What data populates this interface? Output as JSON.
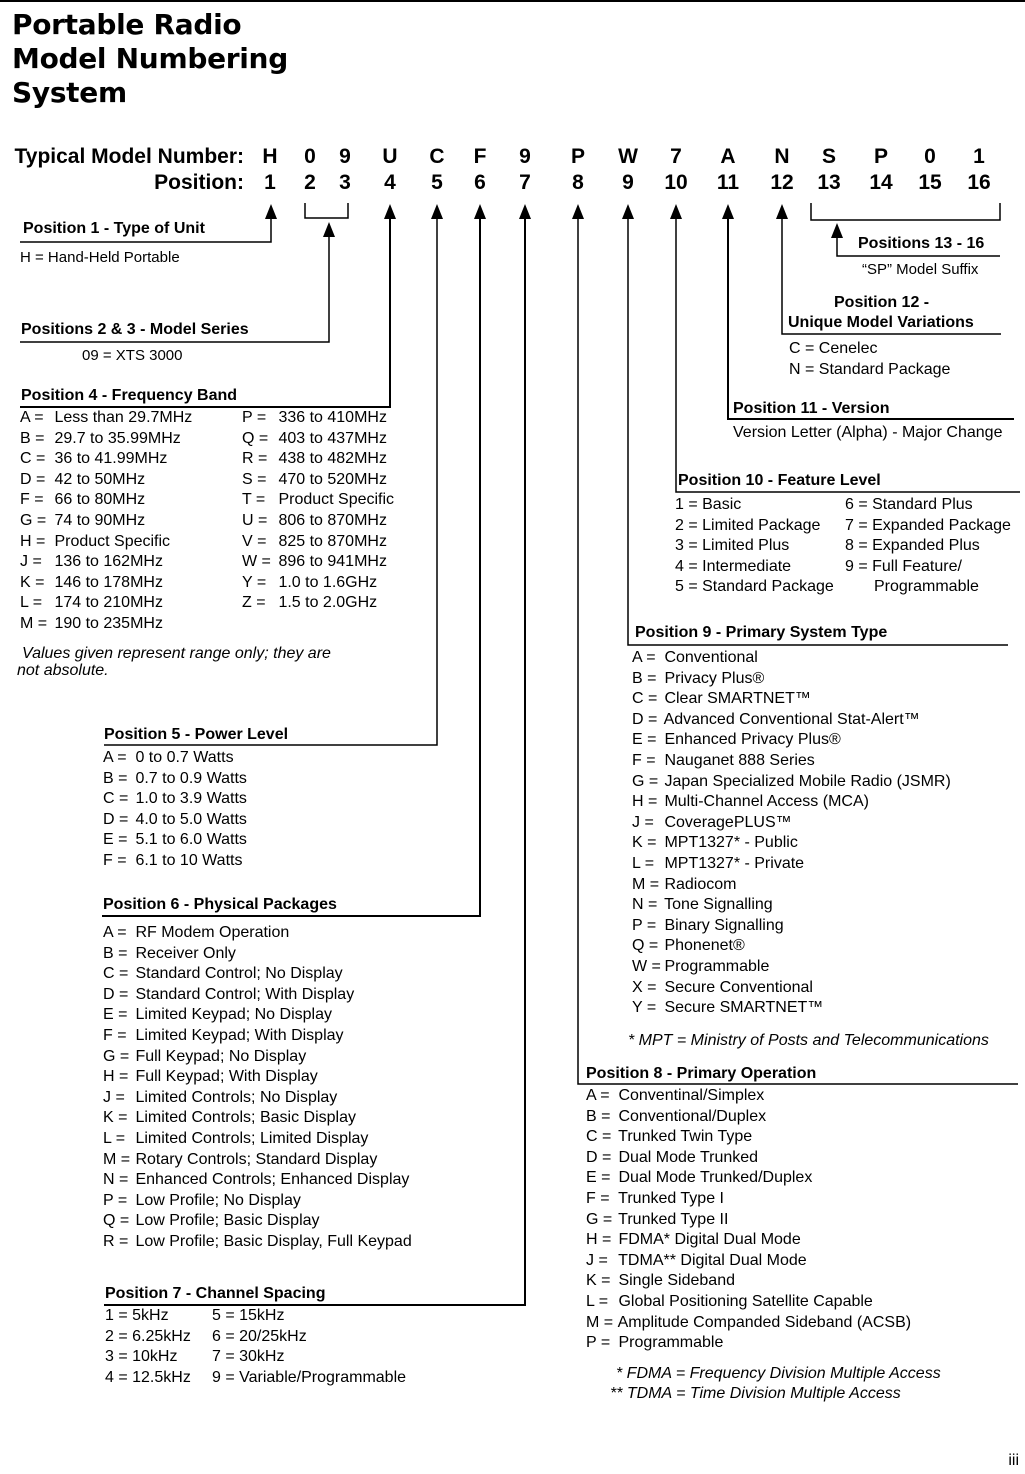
{
  "title": [
    "Portable Radio",
    "Model Numbering",
    "System"
  ],
  "header": {
    "model_label": "Typical Model Number:",
    "position_label": "Position:",
    "model_chars": [
      "H",
      "0",
      "9",
      "U",
      "C",
      "F",
      "9",
      "P",
      "W",
      "7",
      "A",
      "N",
      "S",
      "P",
      "0",
      "1"
    ],
    "positions": [
      "1",
      "2",
      "3",
      "4",
      "5",
      "6",
      "7",
      "8",
      "9",
      "10",
      "11",
      "12",
      "13",
      "14",
      "15",
      "16"
    ]
  },
  "sections": {
    "pos1": {
      "title": "Position 1 - Type of Unit",
      "items": [
        "H = Hand-Held Portable"
      ]
    },
    "pos23": {
      "title": "Positions 2 & 3 - Model Series",
      "items": [
        "09 = XTS 3000"
      ]
    },
    "pos4": {
      "title": "Position 4 - Frequency Band",
      "col1": [
        {
          "k": "A",
          "v": "Less than 29.7MHz"
        },
        {
          "k": "B",
          "v": "29.7 to 35.99MHz"
        },
        {
          "k": "C",
          "v": "36 to 41.99MHz"
        },
        {
          "k": "D",
          "v": "42 to 50MHz"
        },
        {
          "k": "F",
          "v": "66 to 80MHz"
        },
        {
          "k": "G",
          "v": "74 to 90MHz"
        },
        {
          "k": "H",
          "v": "Product Specific"
        },
        {
          "k": "J",
          "v": "136 to 162MHz"
        },
        {
          "k": "K",
          "v": "146 to 178MHz"
        },
        {
          "k": "L",
          "v": "174 to 210MHz"
        },
        {
          "k": "M",
          "v": "190 to 235MHz"
        }
      ],
      "col2": [
        {
          "k": "P",
          "v": "336 to 410MHz"
        },
        {
          "k": "Q",
          "v": "403 to 437MHz"
        },
        {
          "k": "R",
          "v": "438 to 482MHz"
        },
        {
          "k": "S",
          "v": "470 to 520MHz"
        },
        {
          "k": "T",
          "v": "Product Specific"
        },
        {
          "k": "U",
          "v": "806 to 870MHz"
        },
        {
          "k": "V",
          "v": "825 to 870MHz"
        },
        {
          "k": "W",
          "v": "896 to 941MHz"
        },
        {
          "k": "Y",
          "v": "1.0 to 1.6GHz"
        },
        {
          "k": "Z",
          "v": "1.5 to 2.0GHz"
        }
      ],
      "note": [
        "Values given represent range only; they are",
        "not absolute."
      ]
    },
    "pos5": {
      "title": "Position 5 - Power Level",
      "items": [
        {
          "k": "A",
          "v": "0 to 0.7 Watts"
        },
        {
          "k": "B",
          "v": "0.7 to 0.9 Watts"
        },
        {
          "k": "C",
          "v": "1.0 to 3.9 Watts"
        },
        {
          "k": "D",
          "v": "4.0 to 5.0 Watts"
        },
        {
          "k": "E",
          "v": "5.1 to 6.0 Watts"
        },
        {
          "k": "F",
          "v": "6.1 to 10 Watts"
        }
      ]
    },
    "pos6": {
      "title": "Position 6 - Physical Packages",
      "items": [
        {
          "k": "A",
          "v": "RF Modem Operation"
        },
        {
          "k": "B",
          "v": "Receiver Only"
        },
        {
          "k": "C",
          "v": "Standard Control; No Display"
        },
        {
          "k": "D",
          "v": "Standard Control; With Display"
        },
        {
          "k": "E",
          "v": "Limited Keypad; No Display"
        },
        {
          "k": "F",
          "v": "Limited Keypad; With Display"
        },
        {
          "k": "G",
          "v": "Full Keypad; No Display"
        },
        {
          "k": "H",
          "v": "Full Keypad; With Display"
        },
        {
          "k": "J",
          "v": "Limited Controls; No Display"
        },
        {
          "k": "K",
          "v": "Limited Controls; Basic Display"
        },
        {
          "k": "L",
          "v": "Limited Controls; Limited Display"
        },
        {
          "k": "M",
          "v": "Rotary Controls; Standard Display"
        },
        {
          "k": "N",
          "v": "Enhanced Controls; Enhanced Display"
        },
        {
          "k": "P",
          "v": "Low Profile; No Display"
        },
        {
          "k": "Q",
          "v": "Low Profile; Basic Display"
        },
        {
          "k": "R",
          "v": "Low Profile; Basic Display, Full Keypad"
        }
      ]
    },
    "pos7": {
      "title": "Position 7 - Channel Spacing",
      "col1": [
        "1 = 5kHz",
        "2 = 6.25kHz",
        "3 = 10kHz",
        "4 = 12.5kHz"
      ],
      "col2": [
        "5 = 15kHz",
        "6 = 20/25kHz",
        "7 = 30kHz",
        "9 = Variable/Programmable"
      ]
    },
    "pos8": {
      "title": "Position 8 - Primary Operation",
      "items": [
        {
          "k": "A",
          "v": "Conventinal/Simplex"
        },
        {
          "k": "B",
          "v": "Conventional/Duplex"
        },
        {
          "k": "C",
          "v": "Trunked Twin Type"
        },
        {
          "k": "D",
          "v": "Dual Mode Trunked"
        },
        {
          "k": "E",
          "v": "Dual Mode Trunked/Duplex"
        },
        {
          "k": "F",
          "v": "Trunked Type I"
        },
        {
          "k": "G",
          "v": "Trunked Type II"
        },
        {
          "k": "H",
          "v": "FDMA* Digital Dual Mode"
        },
        {
          "k": "J",
          "v": "TDMA** Digital Dual Mode"
        },
        {
          "k": "K",
          "v": "Single Sideband"
        },
        {
          "k": "L",
          "v": "Global Positioning Satellite Capable"
        },
        {
          "k": "M",
          "v": "Amplitude Companded Sideband (ACSB)"
        },
        {
          "k": "P",
          "v": "Programmable"
        }
      ],
      "notes": [
        "* FDMA = Frequency Division Multiple Access",
        "** TDMA = Time Division Multiple Access"
      ]
    },
    "pos9": {
      "title": "Position 9 - Primary System Type",
      "items": [
        {
          "k": "A",
          "v": "Conventional"
        },
        {
          "k": "B",
          "v": "Privacy Plus®"
        },
        {
          "k": "C",
          "v": "Clear SMARTNET™"
        },
        {
          "k": "D",
          "v": "Advanced Conventional Stat-Alert™"
        },
        {
          "k": "E",
          "v": "Enhanced Privacy Plus®"
        },
        {
          "k": "F",
          "v": "Nauganet 888 Series"
        },
        {
          "k": "G",
          "v": "Japan Specialized Mobile Radio (JSMR)"
        },
        {
          "k": "H",
          "v": "Multi-Channel Access (MCA)"
        },
        {
          "k": "J",
          "v": "CoveragePLUS™"
        },
        {
          "k": "K",
          "v": "MPT1327* - Public"
        },
        {
          "k": "L",
          "v": "MPT1327* - Private"
        },
        {
          "k": "M",
          "v": "Radiocom"
        },
        {
          "k": "N",
          "v": "Tone Signalling"
        },
        {
          "k": "P",
          "v": "Binary Signalling"
        },
        {
          "k": "Q",
          "v": "Phonenet®"
        },
        {
          "k": "W",
          "v": "Programmable"
        },
        {
          "k": "X",
          "v": "Secure Conventional"
        },
        {
          "k": "Y",
          "v": "Secure SMARTNET™"
        }
      ],
      "note": "* MPT = Ministry of Posts and Telecommunications"
    },
    "pos10": {
      "title": "Position 10 - Feature Level",
      "col1": [
        "1 = Basic",
        "2 = Limited Package",
        "3 = Limited Plus",
        "4 = Intermediate",
        "5 = Standard Package"
      ],
      "col2": [
        "6 = Standard Plus",
        "7 = Expanded Package",
        "8 = Expanded Plus",
        "9 = Full Feature/",
        "Programmable"
      ]
    },
    "pos11": {
      "title": "Position 11 - Version",
      "items": [
        "Version Letter (Alpha) - Major Change"
      ]
    },
    "pos12": {
      "title": [
        "Position 12 -",
        "Unique Model Variations"
      ],
      "items": [
        "C = Cenelec",
        "N = Standard Package"
      ]
    },
    "pos1316": {
      "title": "Positions 13 - 16",
      "items": [
        "“SP” Model Suffix"
      ]
    }
  },
  "page_number": "iii"
}
